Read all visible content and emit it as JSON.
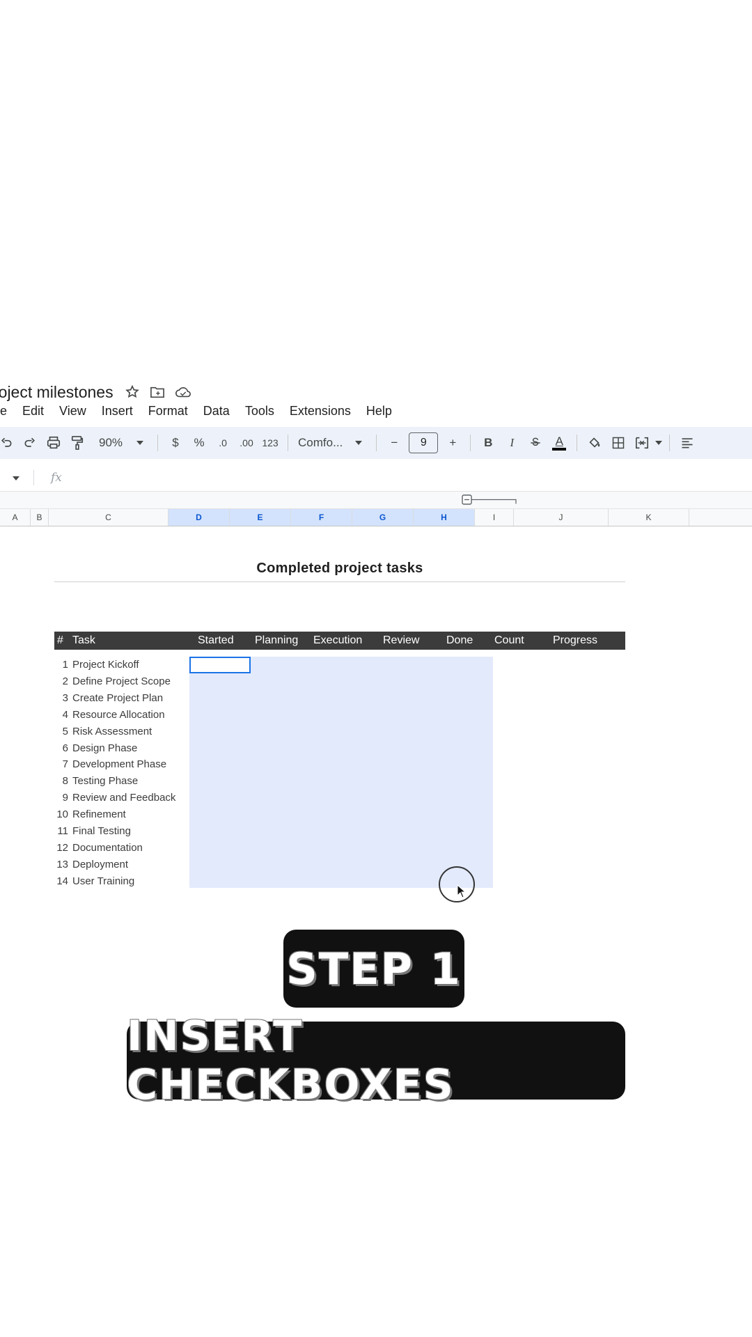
{
  "document": {
    "title": "roject milestones"
  },
  "menu": [
    "ile",
    "Edit",
    "View",
    "Insert",
    "Format",
    "Data",
    "Tools",
    "Extensions",
    "Help"
  ],
  "toolbar": {
    "zoom": "90%",
    "currency": "$",
    "percent": "%",
    "decrease_decimal": ".0",
    "increase_decimal": ".00",
    "number_format": "123",
    "font": "Comfo...",
    "font_size": "9",
    "minus": "−",
    "plus": "+",
    "bold": "B",
    "italic": "I",
    "text_color_letter": "A"
  },
  "formula_bar": {
    "fx": "fx"
  },
  "columns": [
    {
      "label": "A",
      "selected": false
    },
    {
      "label": "B",
      "selected": false
    },
    {
      "label": "C",
      "selected": false
    },
    {
      "label": "D",
      "selected": true
    },
    {
      "label": "E",
      "selected": true
    },
    {
      "label": "F",
      "selected": true
    },
    {
      "label": "G",
      "selected": true
    },
    {
      "label": "H",
      "selected": true
    },
    {
      "label": "I",
      "selected": false
    },
    {
      "label": "J",
      "selected": false
    },
    {
      "label": "K",
      "selected": false
    }
  ],
  "sheet": {
    "title": "Completed project tasks",
    "headers": {
      "num": "#",
      "task": "Task",
      "started": "Started",
      "planning": "Planning",
      "execution": "Execution",
      "review": "Review",
      "done": "Done",
      "count": "Count",
      "progress": "Progress"
    },
    "tasks": [
      {
        "num": "1",
        "name": "Project Kickoff"
      },
      {
        "num": "2",
        "name": "Define Project Scope"
      },
      {
        "num": "3",
        "name": "Create Project Plan"
      },
      {
        "num": "4",
        "name": "Resource Allocation"
      },
      {
        "num": "5",
        "name": "Risk Assessment"
      },
      {
        "num": "6",
        "name": "Design Phase"
      },
      {
        "num": "7",
        "name": "Development Phase"
      },
      {
        "num": "8",
        "name": "Testing Phase"
      },
      {
        "num": "9",
        "name": "Review and Feedback"
      },
      {
        "num": "10",
        "name": "Refinement"
      },
      {
        "num": "11",
        "name": "Final Testing"
      },
      {
        "num": "12",
        "name": "Documentation"
      },
      {
        "num": "13",
        "name": "Deployment"
      },
      {
        "num": "14",
        "name": "User Training"
      }
    ]
  },
  "overlay": {
    "step": "STEP 1",
    "instruction": "INSERT CHECKBOXES"
  },
  "colors": {
    "toolbar_bg": "#edf2fa",
    "selection_bg": "#e3eafc",
    "active_border": "#1a73e8",
    "header_bar": "#3c3c3c"
  }
}
